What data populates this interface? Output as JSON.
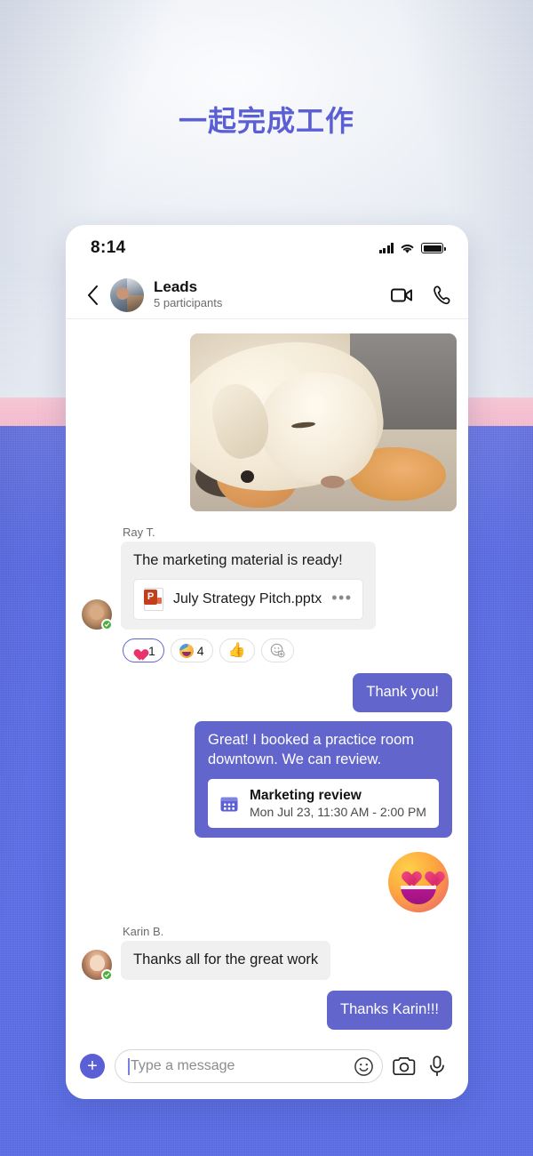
{
  "headline": "一起完成工作",
  "theme": {
    "accent_purple": "#5b5fd6",
    "bubble_out": "#6265cb",
    "bubble_in": "#f0f0f0",
    "bg_pink": "#f4bfd0",
    "bg_blue": "#5d6ee4",
    "presence_green": "#4caf3f",
    "ppt_red": "#c43e1c"
  },
  "status_bar": {
    "time": "8:14",
    "icons": [
      "signal-icon",
      "wifi-icon",
      "battery-icon"
    ]
  },
  "chat_header": {
    "back_icon": "chevron-left-icon",
    "avatar": "group-avatar",
    "title": "Leads",
    "subtitle": "5 participants",
    "video_icon": "video-call-icon",
    "call_icon": "phone-call-icon"
  },
  "messages": [
    {
      "type": "image",
      "alt": "dog-photo"
    },
    {
      "type": "incoming",
      "sender": "Ray T.",
      "text": "The marketing material is ready!",
      "attachment": {
        "kind": "file",
        "icon": "powerpoint-icon",
        "name": "July Strategy Pitch.pptx",
        "more": "•••"
      },
      "reactions": [
        {
          "icon": "heart-reaction",
          "count": "1",
          "selected": true
        },
        {
          "icon": "party-face-reaction",
          "count": "4",
          "selected": false
        },
        {
          "icon": "thumbs-up-reaction",
          "count": "",
          "selected": false
        },
        {
          "icon": "add-reaction-icon",
          "count": "",
          "selected": false
        }
      ]
    },
    {
      "type": "outgoing",
      "text": "Thank you!"
    },
    {
      "type": "outgoing",
      "text": "Great! I booked a practice room downtown. We can review.",
      "attachment": {
        "kind": "calendar",
        "icon": "calendar-icon",
        "title": "Marketing review",
        "subtitle": "Mon Jul 23, 11:30 AM - 2:00 PM"
      }
    },
    {
      "type": "sticker",
      "alt": "heart-eyes-emoji"
    },
    {
      "type": "incoming",
      "sender": "Karin B.",
      "text": "Thanks all for the great work"
    },
    {
      "type": "outgoing",
      "text": "Thanks Karin!!!"
    }
  ],
  "composer": {
    "add_label": "+",
    "placeholder": "Type a message",
    "value": "",
    "emoji_icon": "emoji-icon",
    "camera_icon": "camera-icon",
    "mic_icon": "microphone-icon"
  }
}
